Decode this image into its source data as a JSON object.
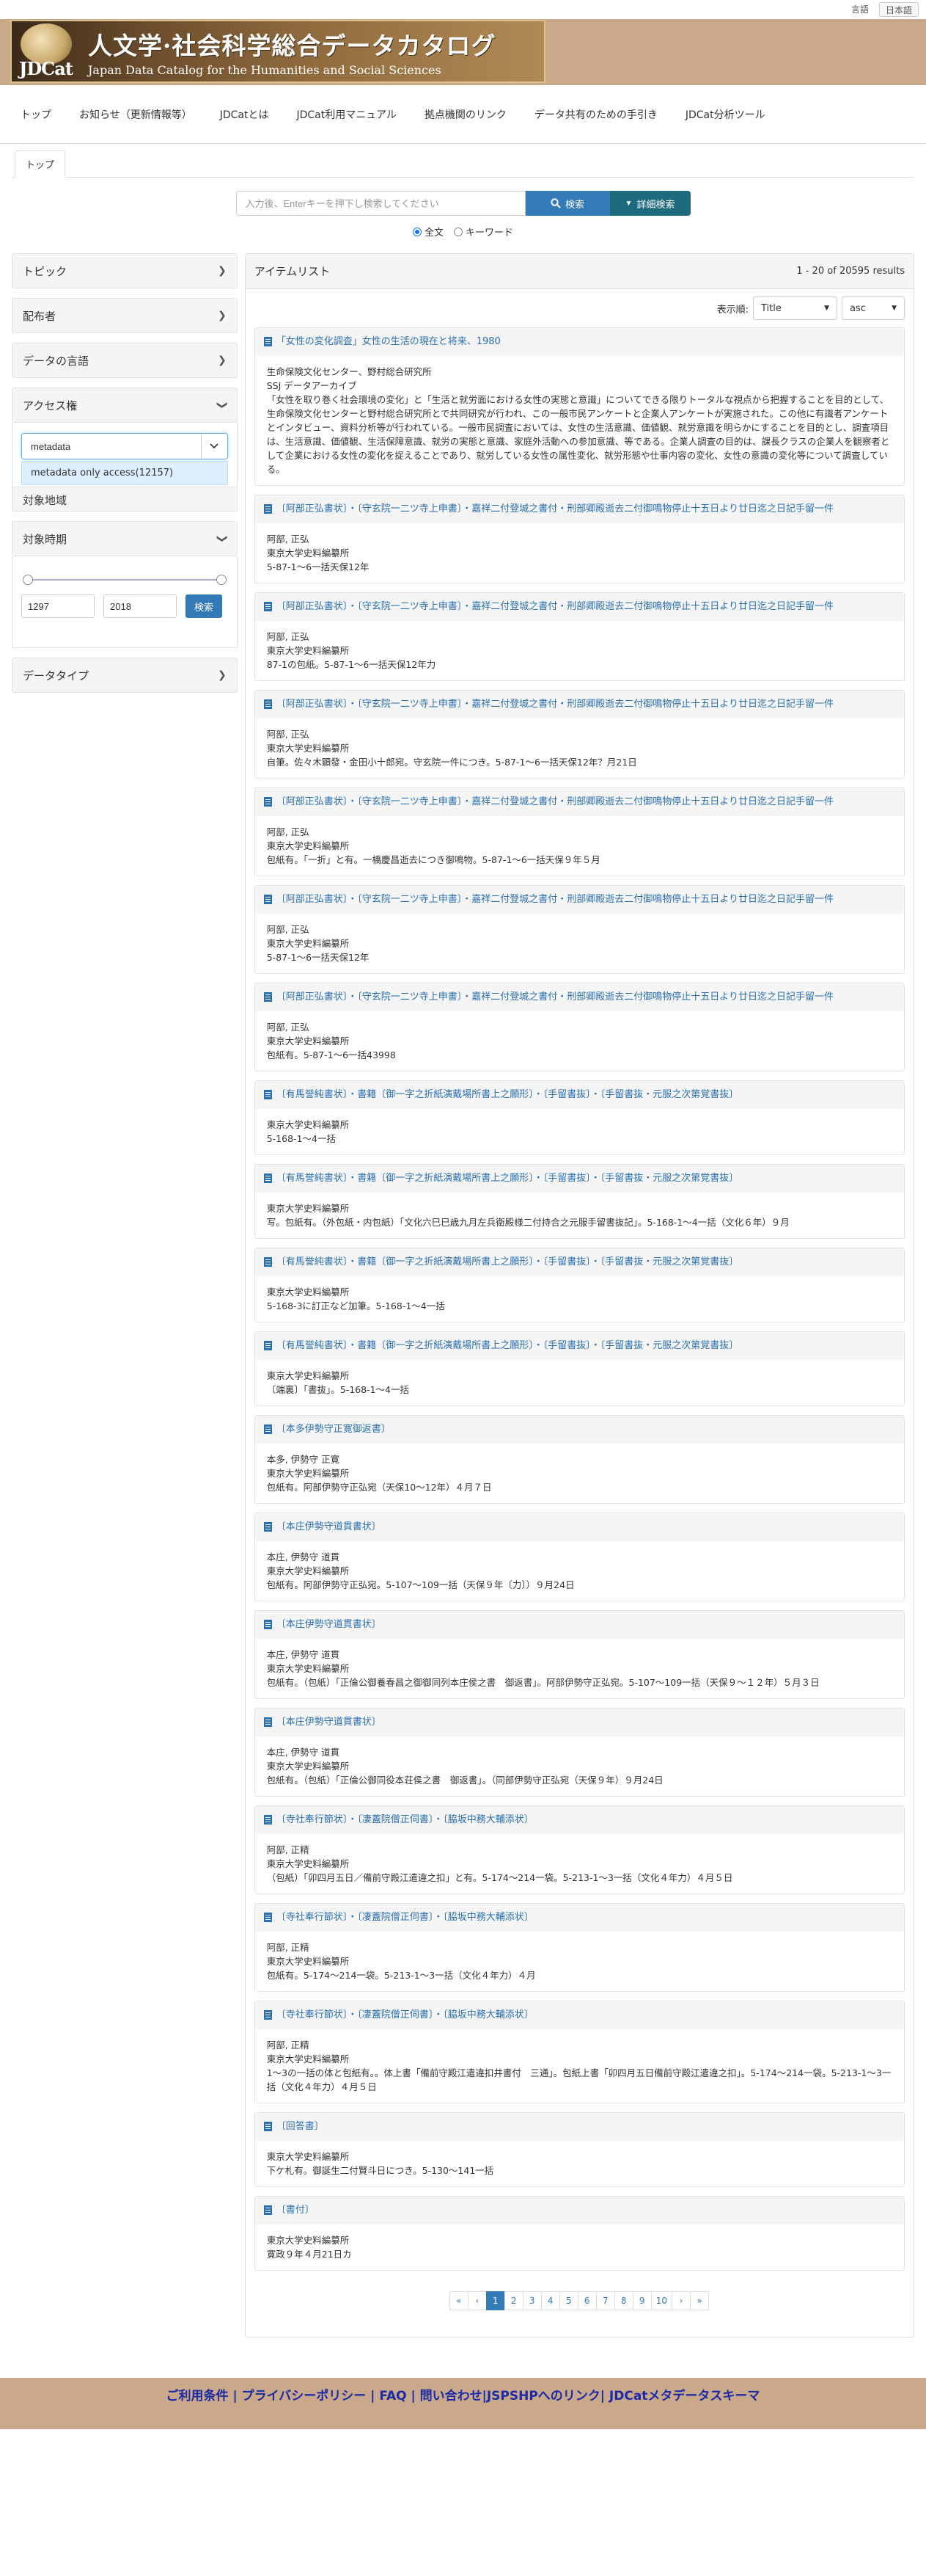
{
  "lang": {
    "en": "言語",
    "ja": "日本語"
  },
  "logo": {
    "jd": "JDCat",
    "title": "人文学·社会科学総合データカタログ",
    "subtitle": "Japan Data Catalog for the Humanities and Social Sciences"
  },
  "nav": [
    "トップ",
    "お知らせ（更新情報等）",
    "JDCatとは",
    "JDCat利用マニュアル",
    "拠点機関のリンク",
    "データ共有のための手引き",
    "JDCat分析ツール"
  ],
  "breadcrumb": "トップ",
  "search": {
    "placeholder": "入力後、Enterキーを押下し検索してください",
    "button": "検索",
    "advanced": "詳細検索",
    "opt_full": "全文",
    "opt_keyword": "キーワード"
  },
  "facets": {
    "topic": "トピック",
    "distributor": "配布者",
    "language": "データの言語",
    "access": "アクセス権",
    "access_input": "metadata",
    "access_option": "metadata only access(12157)",
    "region": "対象地域",
    "period": "対象時期",
    "period_from": "1297",
    "period_to": "2018",
    "period_button": "検索",
    "datatype": "データタイプ"
  },
  "results": {
    "title": "アイテムリスト",
    "count": "1 - 20 of 20595 results",
    "display_label": "表示順:",
    "sort_field": "Title",
    "sort_order": "asc"
  },
  "items": [
    {
      "title": "「女性の変化調査」女性の生活の現在と将来、1980",
      "lines": [
        "生命保険文化センター、野村総合研究所",
        "SSJ データアーカイブ",
        "「女性を取り巻く社会環境の変化」と「生活と就労面における女性の実態と意識」についてできる限りトータルな視点から把握することを目的として、生命保険文化センターと野村総合研究所とで共同研究が行われ、この一般市民アンケートと企業人アンケートが実施された。この他に有識者アンケートとインタビュー、資料分析等が行われている。一般市民調査においては、女性の生活意識、価値観、就労意識を明らかにすることを目的とし、調査項目は、生活意識、価値観、生活保障意識、就労の実態と意識、家庭外活動への参加意識、等である。企業人調査の目的は、課長クラスの企業人を観察者として企業における女性の変化を捉えることであり、就労している女性の属性変化、就労形態や仕事内容の変化、女性の意識の変化等について調査している。"
      ]
    },
    {
      "title": "〔阿部正弘書状〕・〔守玄院一二ツ寺上申書〕・嘉祥二付登城之書付・刑部卿殿逝去二付御鳴物停止十五日より廿日迄之日記手留一件",
      "lines": [
        "阿部, 正弘",
        "東京大学史料編纂所",
        "5-87-1〜6一括天保12年"
      ]
    },
    {
      "title": "〔阿部正弘書状〕・〔守玄院一二ツ寺上申書〕・嘉祥二付登城之書付・刑部卿殿逝去二付御鳴物停止十五日より廿日迄之日記手留一件",
      "lines": [
        "阿部, 正弘",
        "東京大学史料編纂所",
        "87-1の包紙。5-87-1〜6一括天保12年力"
      ]
    },
    {
      "title": "〔阿部正弘書状〕・〔守玄院一二ツ寺上申書〕・嘉祥二付登城之書付・刑部卿殿逝去二付御鳴物停止十五日より廿日迄之日記手留一件",
      "lines": [
        "阿部, 正弘",
        "東京大学史料編纂所",
        "自筆。佐々木顕發・金田小十郎宛。守玄院一件につき。5-87-1〜6一括天保12年？月21日"
      ]
    },
    {
      "title": "〔阿部正弘書状〕・〔守玄院一二ツ寺上申書〕・嘉祥二付登城之書付・刑部卿殿逝去二付御鳴物停止十五日より廿日迄之日記手留一件",
      "lines": [
        "阿部, 正弘",
        "東京大学史料編纂所",
        "包紙有。「一折」と有。一橋慶昌逝去につき御鳴物。5-87-1〜6一括天保９年５月"
      ]
    },
    {
      "title": "〔阿部正弘書状〕・〔守玄院一二ツ寺上申書〕・嘉祥二付登城之書付・刑部卿殿逝去二付御鳴物停止十五日より廿日迄之日記手留一件",
      "lines": [
        "阿部, 正弘",
        "東京大学史料編纂所",
        "5-87-1〜6一括天保12年"
      ]
    },
    {
      "title": "〔阿部正弘書状〕・〔守玄院一二ツ寺上申書〕・嘉祥二付登城之書付・刑部卿殿逝去二付御鳴物停止十五日より廿日迄之日記手留一件",
      "lines": [
        "阿部, 正弘",
        "東京大学史料編纂所",
        "包紙有。5-87-1〜6一括43998"
      ]
    },
    {
      "title": "〔有馬誉純書状〕・書籍〔御一字之折紙演戴場所書上之願形〕・〔手留書抜〕・〔手留書抜・元服之次第覚書抜〕",
      "lines": [
        "東京大学史料編纂所",
        "5-168-1〜4一括"
      ]
    },
    {
      "title": "〔有馬誉純書状〕・書籍〔御一字之折紙演戴場所書上之願形〕・〔手留書抜〕・〔手留書抜・元服之次第覚書抜〕",
      "lines": [
        "東京大学史料編纂所",
        "写。包紙有。（外包紙・内包紙）「文化六巳巳歳九月左兵衛殿様二付持合之元服手留書抜記」。5-168-1〜4一括（文化６年）９月"
      ]
    },
    {
      "title": "〔有馬誉純書状〕・書籍〔御一字之折紙演戴場所書上之願形〕・〔手留書抜〕・〔手留書抜・元服之次第覚書抜〕",
      "lines": [
        "東京大学史料編纂所",
        "5-168-3に訂正など加筆。5-168-1〜4一括"
      ]
    },
    {
      "title": "〔有馬誉純書状〕・書籍〔御一字之折紙演戴場所書上之願形〕・〔手留書抜〕・〔手留書抜・元服之次第覚書抜〕",
      "lines": [
        "東京大学史料編纂所",
        "〔端裏〕「書抜」。5-168-1〜4一括"
      ]
    },
    {
      "title": "〔本多伊勢守正寛御返書〕",
      "lines": [
        "本多, 伊勢守 正寛",
        "東京大学史料編纂所",
        "包紙有。阿部伊勢守正弘宛（天保10〜12年）４月７日"
      ]
    },
    {
      "title": "〔本庄伊勢守道貫書状〕",
      "lines": [
        "本庄, 伊勢守 道貫",
        "東京大学史料編纂所",
        "包紙有。阿部伊勢守正弘宛。5-107〜109一括（天保９年〔力〕）９月24日"
      ]
    },
    {
      "title": "〔本庄伊勢守道貫書状〕",
      "lines": [
        "本庄, 伊勢守 道貫",
        "東京大学史料編纂所",
        "包紙有。（包紙）「正倫公御養春昌之御御同列本庄侯之書　御返書」。阿部伊勢守正弘宛。5-107〜109一括（天保９〜１２年）５月３日"
      ]
    },
    {
      "title": "〔本庄伊勢守道貫書状〕",
      "lines": [
        "本庄, 伊勢守 道貫",
        "東京大学史料編纂所",
        "包紙有。（包紙）「正倫公御同役本荘侯之書　御返書」。（同部伊勢守正弘宛（天保９年）９月24日"
      ]
    },
    {
      "title": "〔寺社奉行節状〕・〔凄蓋院僧正伺書〕・〔脇坂中務大輔添状〕",
      "lines": [
        "阿部, 正精",
        "東京大学史料編纂所",
        "（包紙）「卯四月五日／備前守殿江遣違之扣」と有。5-174〜214一袋。5-213-1〜3一括（文化４年力）４月５日"
      ]
    },
    {
      "title": "〔寺社奉行節状〕・〔凄蓋院僧正伺書〕・〔脇坂中務大輔添状〕",
      "lines": [
        "阿部, 正精",
        "東京大学史料編纂所",
        "包紙有。5-174〜214一袋。5-213-1〜3一括（文化４年力）４月"
      ]
    },
    {
      "title": "〔寺社奉行節状〕・〔凄蓋院僧正伺書〕・〔脇坂中務大輔添状〕",
      "lines": [
        "阿部, 正精",
        "東京大学史料編纂所",
        "1〜3の一括の体と包紙有。。体上書「備前守殿江遣違扣井書付　三通」。包紙上書「卯四月五日備前守殿江遣違之扣」。5-174〜214一袋。5-213-1〜3一括（文化４年力）４月５日"
      ]
    },
    {
      "title": "〔回答書〕",
      "lines": [
        "東京大学史料編纂所",
        "下ケ札有。御誕生二付賢斗日につき。5-130〜141一括"
      ]
    },
    {
      "title": "〔書付〕",
      "lines": [
        "東京大学史料編纂所",
        "寛政９年４月21日カ"
      ]
    }
  ],
  "pager": [
    "«",
    "‹",
    "1",
    "2",
    "3",
    "4",
    "5",
    "6",
    "7",
    "8",
    "9",
    "10",
    "›",
    "»"
  ],
  "pager_active": "1",
  "footer": "ご利用条件 | プライバシーポリシー | FAQ | 問い合わせ|JSPSHPへのリンク| JDCatメタデータスキーマ"
}
